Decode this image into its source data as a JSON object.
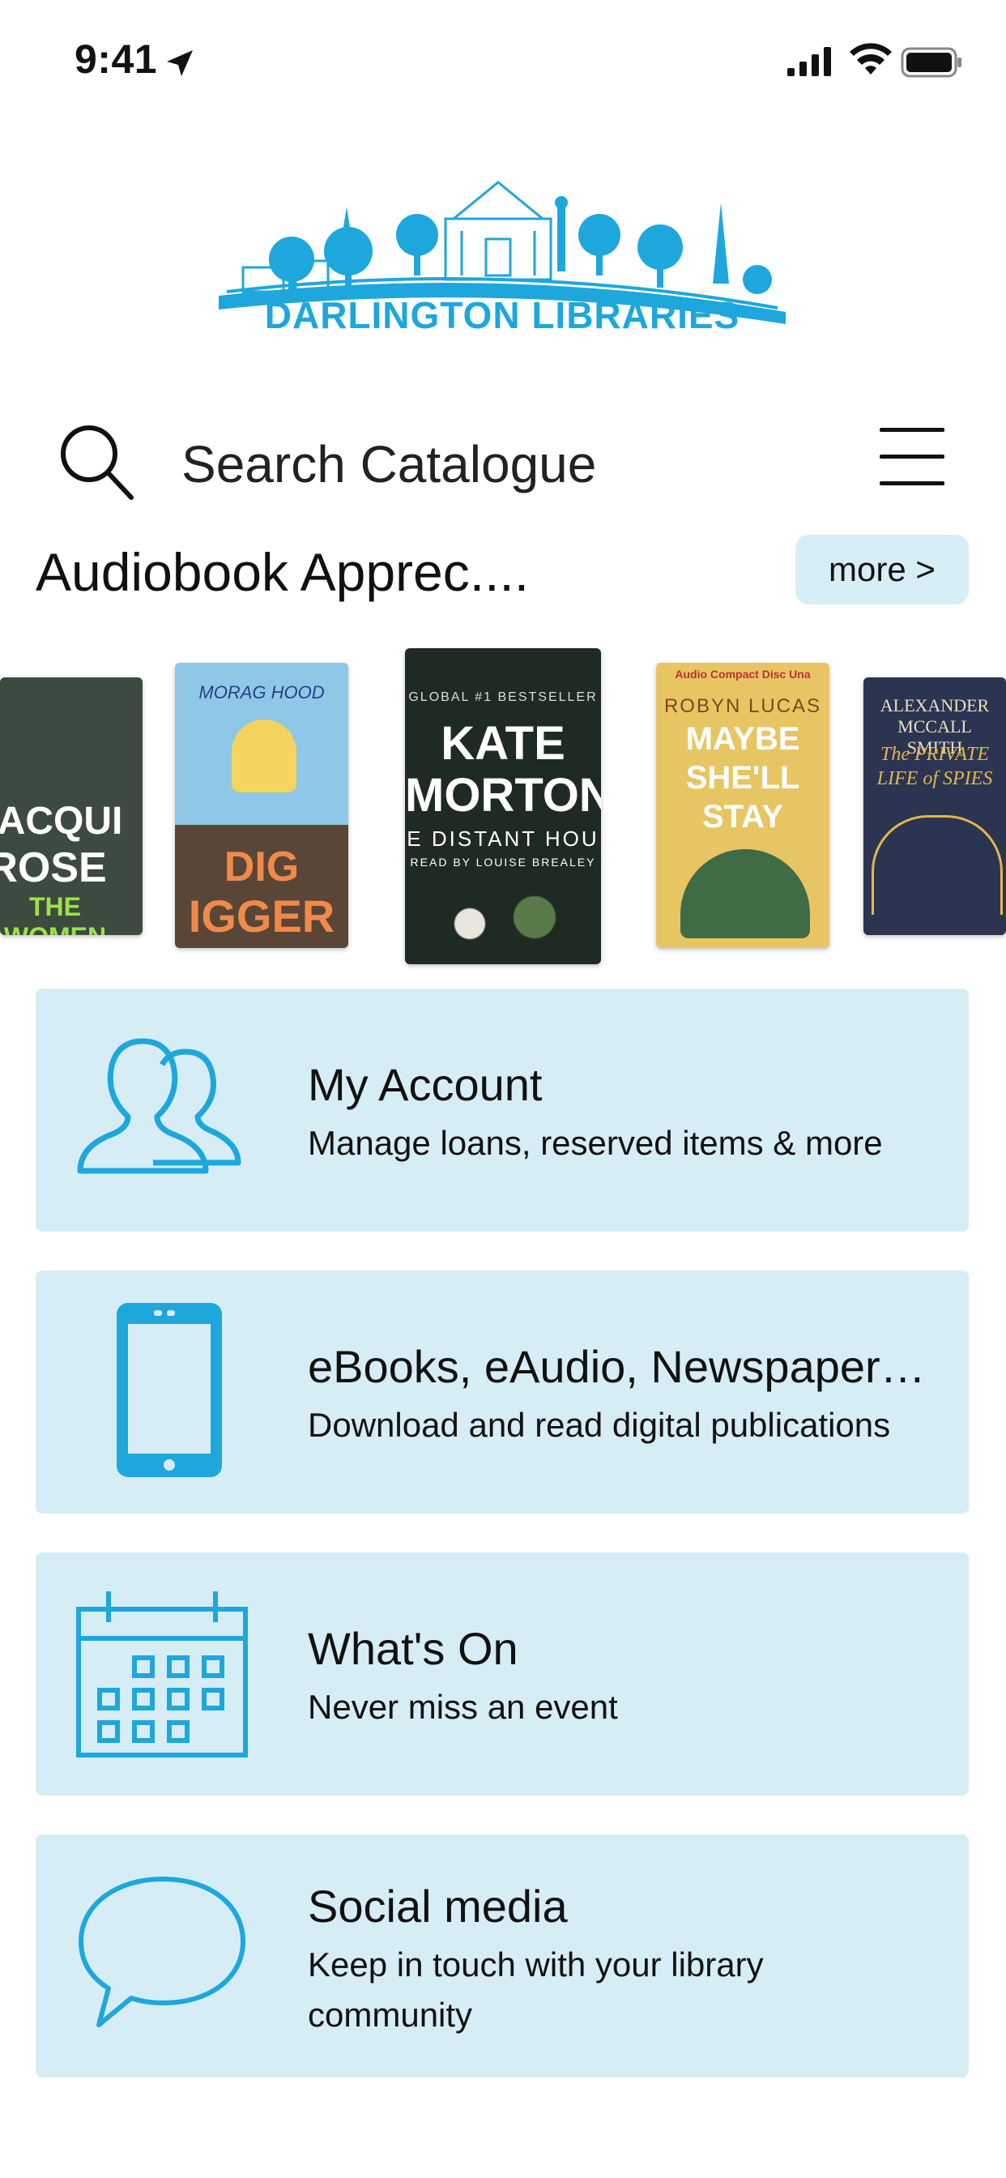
{
  "status_bar": {
    "time": "9:41"
  },
  "logo": {
    "text": "DARLINGTON LIBRARIES"
  },
  "search": {
    "placeholder": "Search Catalogue"
  },
  "section": {
    "title": "Audiobook Apprec....",
    "more_label": "more >"
  },
  "books": [
    {
      "title_lines": [
        "JACQUI",
        "ROSE",
        "THE WOMEN"
      ]
    },
    {
      "author": "MORAG HOOD",
      "title_lines": [
        "G",
        "DIG",
        "IGGER"
      ]
    },
    {
      "top": "GLOBAL #1 BESTSELLER",
      "title_lines": [
        "KATE",
        "MORTON"
      ],
      "subtitle": "E DISTANT HOU",
      "narrator": "READ BY LOUISE BREALEY"
    },
    {
      "top": "Audio Compact Disc  Una",
      "author": "ROBYN LUCAS",
      "title_lines": [
        "MAYBE",
        "SHE'LL",
        "STAY"
      ]
    },
    {
      "author": "ALEXANDER MCCALL SMITH",
      "title_lines": [
        "The PRIVATE",
        "LIFE of SPIES"
      ]
    }
  ],
  "menu": [
    {
      "title": "My Account",
      "subtitle": "Manage loans, reserved items & more",
      "icon": "people-icon"
    },
    {
      "title": "eBooks, eAudio, Newspaper…",
      "subtitle": "Download and read digital publications",
      "icon": "phone-icon"
    },
    {
      "title": "What's On",
      "subtitle": "Never miss an event",
      "icon": "calendar-icon"
    },
    {
      "title": "Social media",
      "subtitle": "Keep in touch with your library community",
      "icon": "speech-bubble-icon"
    }
  ],
  "colors": {
    "accent": "#1ea7dc",
    "card_bg": "#d6edf5",
    "more_bg": "#d8eef6"
  }
}
